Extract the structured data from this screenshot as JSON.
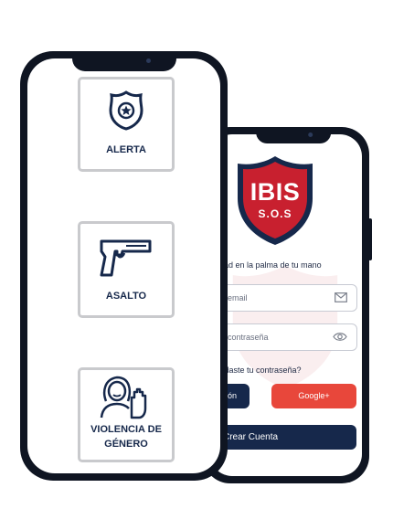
{
  "login_screen": {
    "logo": {
      "title": "IBIS",
      "subtitle": "S.O.S",
      "color_red": "#c8202f",
      "color_navy": "#16284b"
    },
    "tagline": "uridad en la palma de tu mano",
    "email_field": {
      "placeholder": "su email",
      "icon": "mail-icon"
    },
    "password_field": {
      "placeholder": "su contraseña",
      "icon": "eye-icon"
    },
    "forgot_link": "Olvidaste tu contraseña?",
    "login_button": "Sesión",
    "google_button": "Google+",
    "create_account_button": "Crear Cuenta"
  },
  "menu_screen": {
    "options": [
      {
        "label": "ALERTA",
        "icon": "police-badge-icon"
      },
      {
        "label": "ASALTO",
        "icon": "pistol-icon"
      },
      {
        "label_line1": "VIOLENCIA DE",
        "label_line2": "GÉNERO",
        "icon": "woman-stop-hand-icon"
      }
    ]
  },
  "colors": {
    "navy": "#16284b",
    "red": "#e8473b",
    "card_border": "#c9cacd"
  }
}
